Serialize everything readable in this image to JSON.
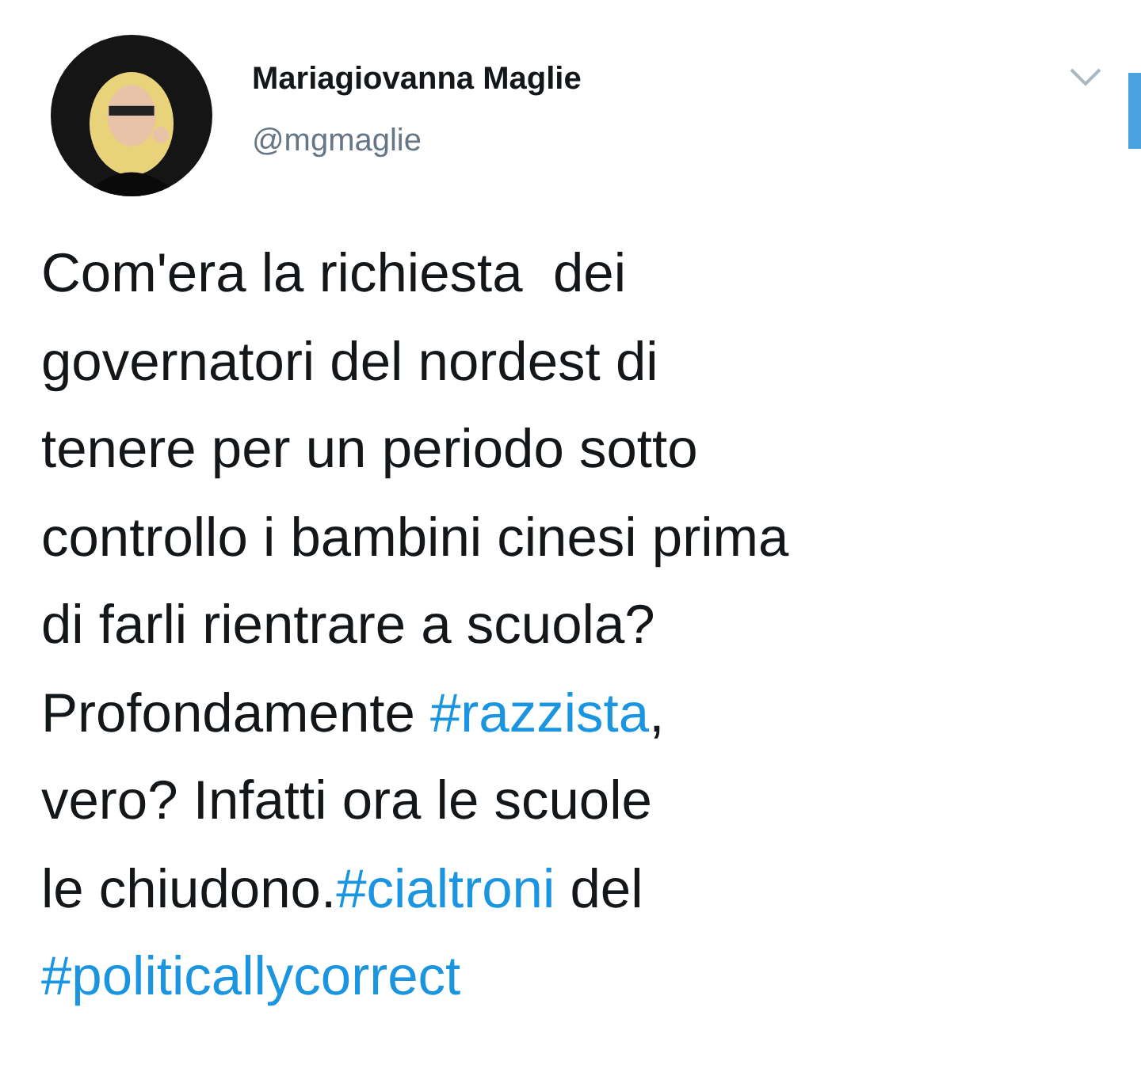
{
  "author": {
    "name": "Mariagiovanna Maglie",
    "handle": "@mgmaglie"
  },
  "menu": {
    "expanded": false
  },
  "lines": [
    [
      {
        "kind": "text",
        "text": "Com'era la richiesta  dei"
      }
    ],
    [
      {
        "kind": "text",
        "text": "governatori del nordest di"
      }
    ],
    [
      {
        "kind": "text",
        "text": "tenere per un periodo sotto"
      }
    ],
    [
      {
        "kind": "text",
        "text": "controllo i bambini cinesi prima"
      }
    ],
    [
      {
        "kind": "text",
        "text": "di farli rientrare a scuola?"
      }
    ],
    [
      {
        "kind": "text",
        "text": "Profondamente "
      },
      {
        "kind": "hashtag",
        "text": "#razzista"
      },
      {
        "kind": "text",
        "text": ","
      }
    ],
    [
      {
        "kind": "text",
        "text": "vero? Infatti ora le scuole"
      }
    ],
    [
      {
        "kind": "text",
        "text": "le chiudono."
      },
      {
        "kind": "hashtag",
        "text": "#cialtroni"
      },
      {
        "kind": "text",
        "text": " del"
      }
    ],
    [
      {
        "kind": "hashtag",
        "text": "#politicallycorrect"
      }
    ]
  ]
}
